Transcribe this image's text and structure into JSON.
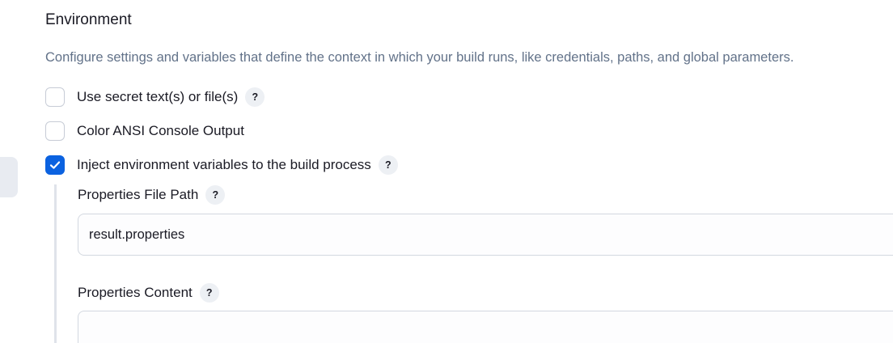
{
  "section": {
    "title": "Environment",
    "description": "Configure settings and variables that define the context in which your build runs, like credentials, paths, and global parameters."
  },
  "options": [
    {
      "label": "Use secret text(s) or file(s)",
      "checked": false,
      "has_help": true
    },
    {
      "label": "Color ANSI Console Output",
      "checked": false,
      "has_help": false
    },
    {
      "label": "Inject environment variables to the build process",
      "checked": true,
      "has_help": true
    }
  ],
  "inject": {
    "properties_file_path": {
      "label": "Properties File Path",
      "value": "result.properties"
    },
    "properties_content": {
      "label": "Properties Content",
      "value": ""
    }
  },
  "help_glyph": "?",
  "colors": {
    "accent": "#0b62e0",
    "description_text": "#627289",
    "help_bg": "#edf0f4"
  },
  "icons": {
    "check": "checkmark-icon",
    "help": "question-mark-icon"
  }
}
